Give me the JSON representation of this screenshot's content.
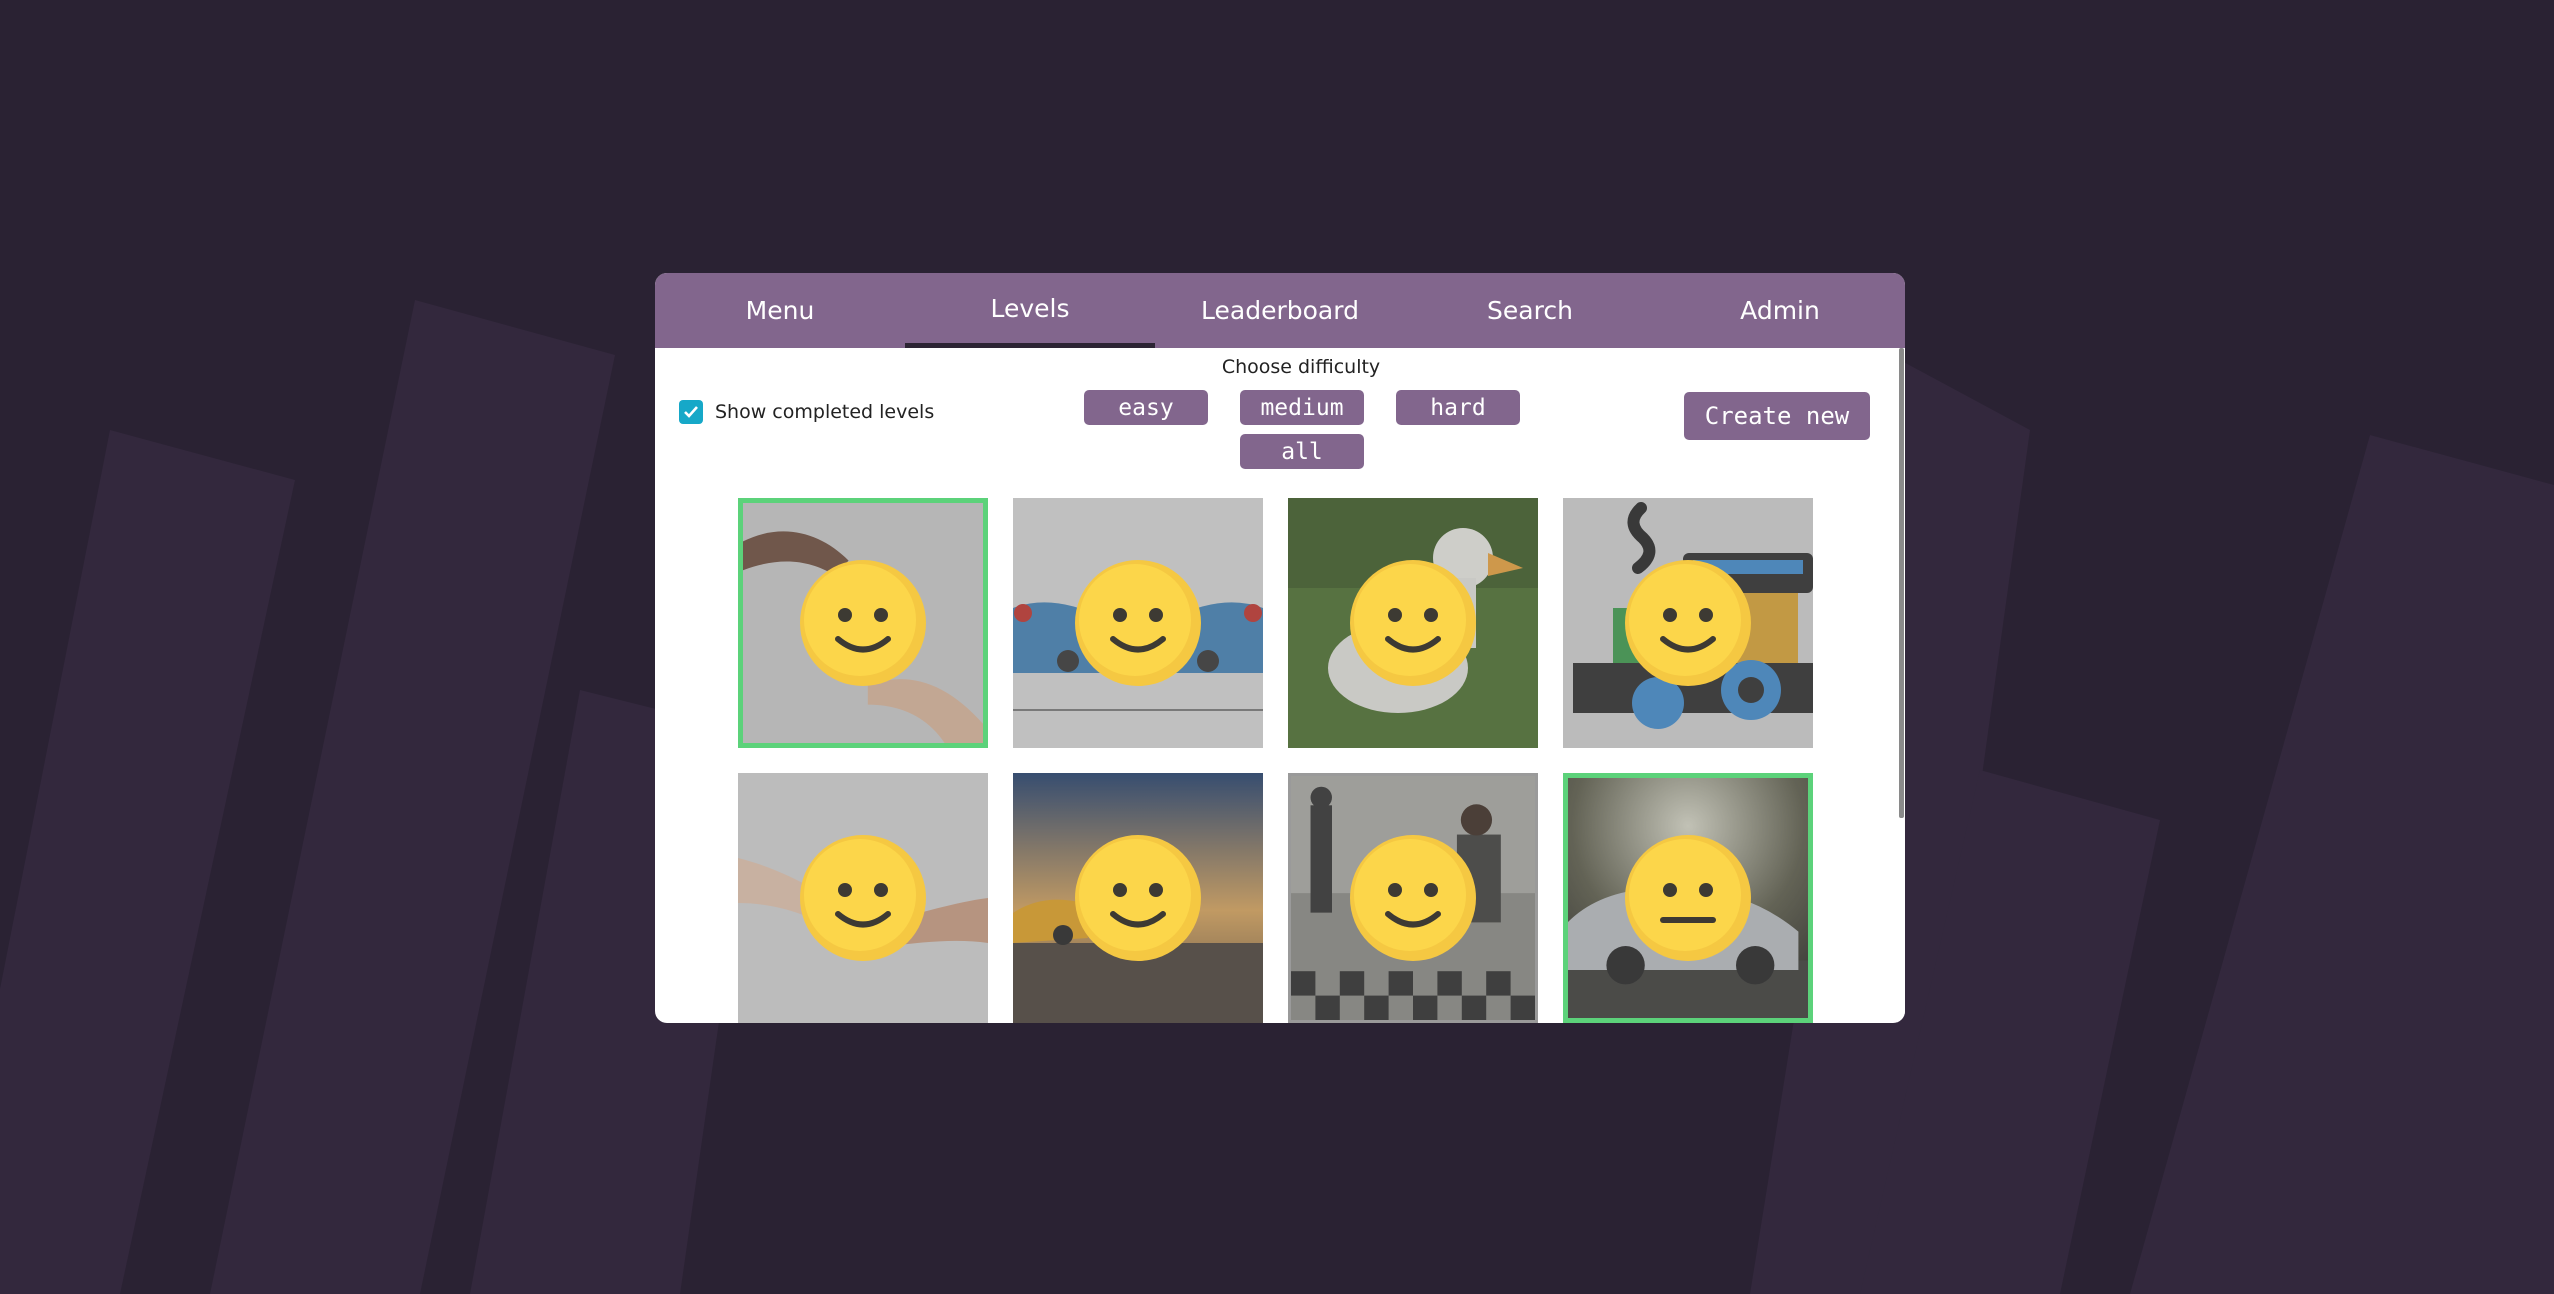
{
  "colors": {
    "background": "#2a2233",
    "stripes": "#33283d",
    "accent": "#82668d",
    "completed_border": "#5cd27a",
    "checkbox": "#16a8c8"
  },
  "nav": {
    "tabs": [
      {
        "label": "Menu"
      },
      {
        "label": "Levels",
        "active": true
      },
      {
        "label": "Leaderboard"
      },
      {
        "label": "Search"
      },
      {
        "label": "Admin"
      }
    ]
  },
  "filters": {
    "show_completed_label": "Show completed levels",
    "show_completed_checked": true,
    "difficulty_title": "Choose difficulty",
    "difficulties": [
      "easy",
      "medium",
      "hard",
      "all"
    ]
  },
  "create_button_label": "Create new",
  "levels": [
    {
      "image": "hands-icon",
      "face": "smile-face-icon",
      "completed": true
    },
    {
      "image": "toy-car-icon",
      "face": "smile-face-icon",
      "completed": false
    },
    {
      "image": "duck-icon",
      "face": "smile-face-icon",
      "completed": false
    },
    {
      "image": "train-icon",
      "face": "smile-face-icon",
      "completed": false
    },
    {
      "image": "hands-icon",
      "face": "smile-face-icon",
      "completed": false
    },
    {
      "image": "sports-car-icon",
      "face": "smile-face-icon",
      "completed": false
    },
    {
      "image": "hallway-people-icon",
      "face": "smile-face-icon",
      "completed": false
    },
    {
      "image": "silver-car-icon",
      "face": "neutral-face-icon",
      "completed": true
    }
  ]
}
